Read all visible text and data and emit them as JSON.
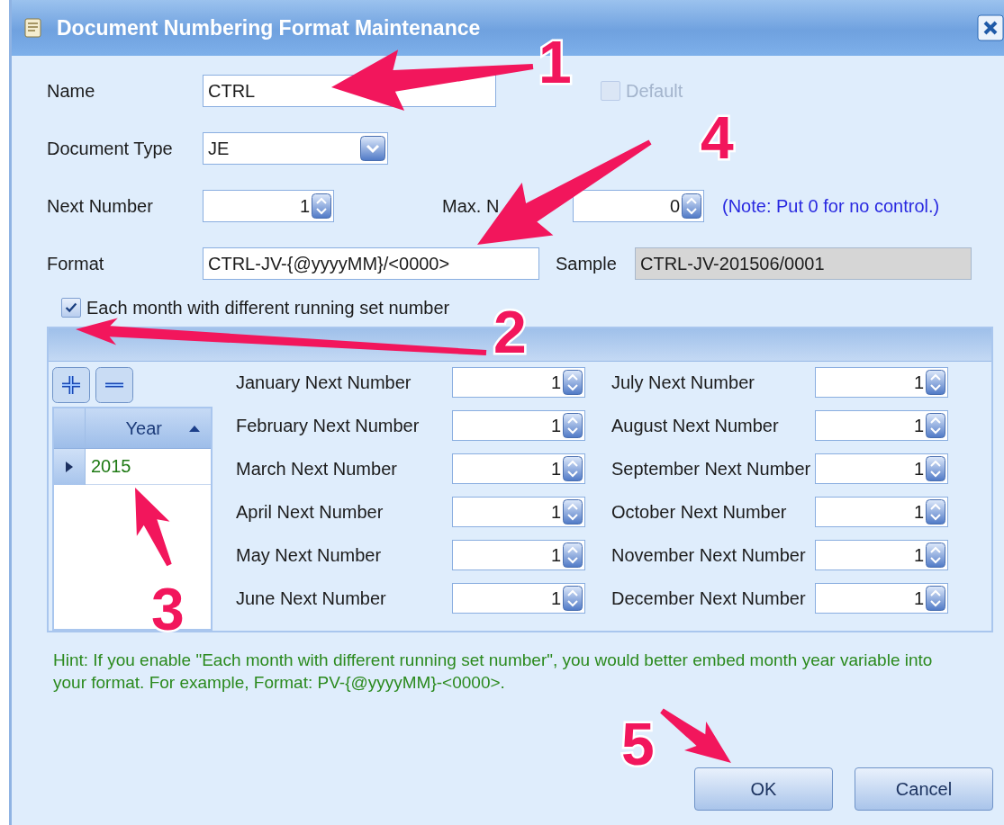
{
  "window": {
    "title": "Document Numbering Format Maintenance"
  },
  "form": {
    "name": {
      "label": "Name",
      "value": "CTRL"
    },
    "default": {
      "label": "Default",
      "checked": false,
      "disabled": true
    },
    "document_type": {
      "label": "Document Type",
      "value": "JE"
    },
    "next_number": {
      "label": "Next Number",
      "value": "1"
    },
    "max_number": {
      "label": "Max. N",
      "value": "0"
    },
    "note": "(Note: Put 0 for no control.)",
    "format": {
      "label": "Format",
      "value": "CTRL-JV-{@yyyyMM}/<0000>"
    },
    "sample": {
      "label": "Sample",
      "value": "CTRL-JV-201506/0001"
    }
  },
  "each_month": {
    "label": "Each month with different running set number",
    "checked": true
  },
  "year_grid": {
    "column": "Year",
    "sort_ascending": true,
    "rows": [
      {
        "year": "2015",
        "selected": true
      }
    ]
  },
  "months": [
    {
      "label": "January Next Number",
      "value": "1"
    },
    {
      "label": "February Next Number",
      "value": "1"
    },
    {
      "label": "March Next Number",
      "value": "1"
    },
    {
      "label": "April Next Number",
      "value": "1"
    },
    {
      "label": "May Next Number",
      "value": "1"
    },
    {
      "label": "June Next Number",
      "value": "1"
    },
    {
      "label": "July Next Number",
      "value": "1"
    },
    {
      "label": "August Next Number",
      "value": "1"
    },
    {
      "label": "September Next Number",
      "value": "1"
    },
    {
      "label": "October Next Number",
      "value": "1"
    },
    {
      "label": "November Next Number",
      "value": "1"
    },
    {
      "label": "December Next Number",
      "value": "1"
    }
  ],
  "hint": "Hint: If you enable \"Each month with different running set number\", you would better embed month year variable into your format. For example, Format: PV-{@yyyyMM}-<0000>.",
  "buttons": [
    {
      "label": "OK"
    },
    {
      "label": "Cancel"
    }
  ],
  "annotations": [
    {
      "label": "1"
    },
    {
      "label": "2"
    },
    {
      "label": "3"
    },
    {
      "label": "4"
    },
    {
      "label": "5"
    }
  ]
}
